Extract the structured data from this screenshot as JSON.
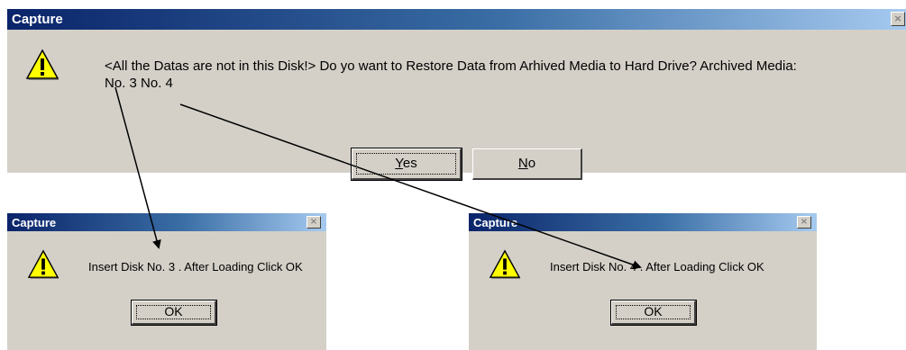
{
  "restore_dialog": {
    "title": "Capture",
    "close_glyph": "×",
    "message_line1": "<All the Datas are not in this Disk!>  Do yo want to Restore Data from Arhived Media to Hard Drive?    Archived Media:",
    "message_line2": "No. 3  No. 4",
    "yes_access_key": "Y",
    "yes_rest": "es",
    "no_access_key": "N",
    "no_rest": "o",
    "icon": "warning-icon"
  },
  "disk3_dialog": {
    "title": "Capture",
    "close_glyph": "×",
    "message": "Insert Disk No. 3 . After Loading Click OK",
    "ok_label": "OK",
    "icon": "warning-icon"
  },
  "disk4_dialog": {
    "title": "Capture",
    "close_glyph": "×",
    "message": "Insert Disk No. 4 . After Loading Click OK",
    "ok_label": "OK",
    "icon": "warning-icon"
  },
  "colors": {
    "dialog_face": "#d4d0c8",
    "titlebar_start": "#0a246a",
    "titlebar_end": "#a6caf0",
    "warning_yellow": "#ffff00",
    "arrow": "#000000"
  }
}
